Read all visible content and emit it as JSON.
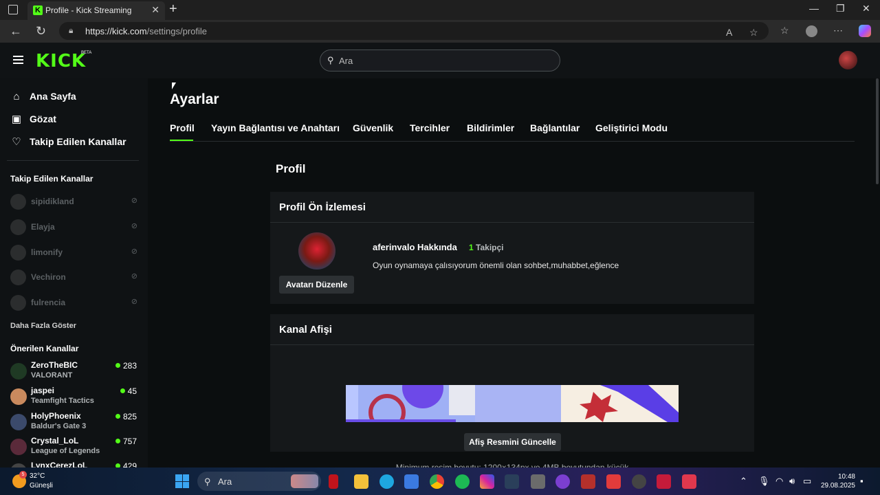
{
  "browser": {
    "tab_title": "Profile - Kick Streaming",
    "tab_favicon": "K",
    "url_host": "https://kick.com",
    "url_path": "/settings/profile"
  },
  "header": {
    "logo": "KICK",
    "logo_badge": "BETA",
    "search_placeholder": "Ara"
  },
  "sidebar": {
    "nav": [
      {
        "label": "Ana Sayfa",
        "icon": "home-icon"
      },
      {
        "label": "Gözat",
        "icon": "browse-icon"
      },
      {
        "label": "Takip Edilen Kanallar",
        "icon": "heart-icon"
      }
    ],
    "followed_heading": "Takip Edilen Kanallar",
    "followed": [
      {
        "name": "sipidikland"
      },
      {
        "name": "Elayja"
      },
      {
        "name": "limonify"
      },
      {
        "name": "Vechiron"
      },
      {
        "name": "fulrencia"
      }
    ],
    "show_more": "Daha Fazla Göster",
    "suggested_heading": "Önerilen Kanallar",
    "suggested": [
      {
        "name": "ZeroTheBIC",
        "game": "VALORANT",
        "viewers": "283",
        "avatar_color": "#1f3a24"
      },
      {
        "name": "jaspei",
        "game": "Teamfight Tactics",
        "viewers": "45",
        "avatar_color": "#c98a5e"
      },
      {
        "name": "HolyPhoenix",
        "game": "Baldur's Gate 3",
        "viewers": "825",
        "avatar_color": "#3b4a6b"
      },
      {
        "name": "Crystal_LoL",
        "game": "League of Legends",
        "viewers": "757",
        "avatar_color": "#5a2a3a"
      },
      {
        "name": "LynxCerezLoL",
        "game": "",
        "viewers": "429",
        "avatar_color": "#444444"
      }
    ]
  },
  "main": {
    "page_title": "Ayarlar",
    "tabs": [
      "Profil",
      "Yayın Bağlantısı ve Anahtarı",
      "Güvenlik",
      "Tercihler",
      "Bildirimler",
      "Bağlantılar",
      "Geliştirici Modu"
    ],
    "section_title": "Profil",
    "preview": {
      "heading": "Profil Ön İzlemesi",
      "edit_avatar": "Avatarı Düzenle",
      "about": "aferinvalo Hakkında",
      "followers_count": "1",
      "followers_label": "Takipçi",
      "bio": "Oyun oynamaya çalısıyorum önemli olan sohbet,muhabbet,eğlence"
    },
    "banner": {
      "heading": "Kanal Afişi",
      "update_button": "Afiş Resmini Güncelle",
      "note": "Minimum resim boyutu: 1200×134px ve 4MB boyutundan küçük"
    }
  },
  "taskbar": {
    "temperature": "32°C",
    "weather": "Güneşli",
    "weather_badge": "5",
    "search": "Ara",
    "time": "10:48",
    "date": "29.08.2025"
  },
  "colors": {
    "accent": "#53fc18",
    "background": "#0b0e0f",
    "card": "#15181a"
  }
}
